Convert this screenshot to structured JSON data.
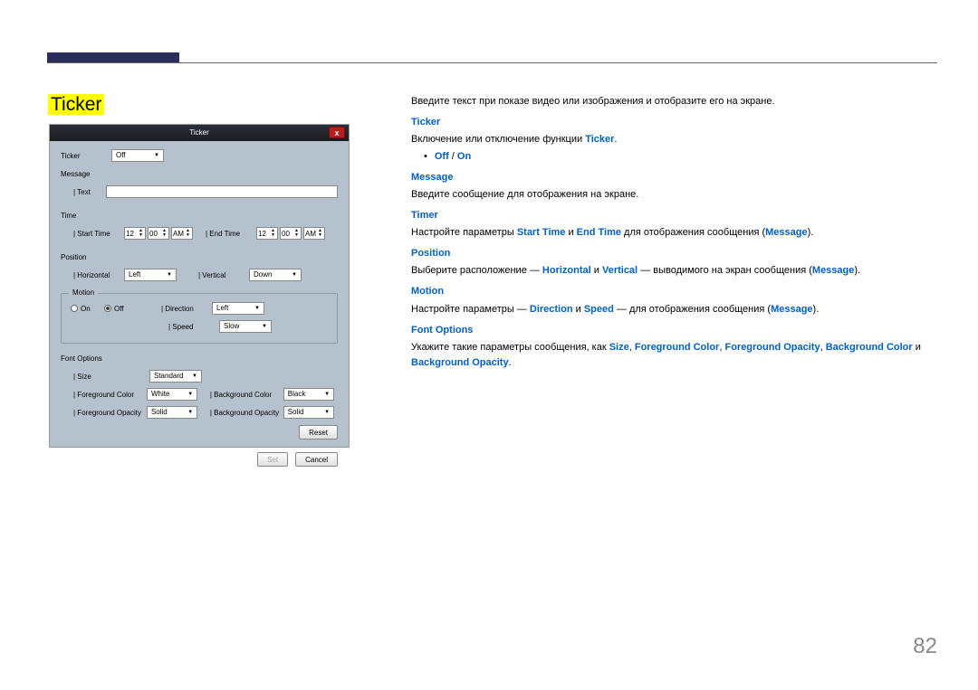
{
  "section_title": "Ticker",
  "panel": {
    "title": "Ticker",
    "close": "x",
    "ticker_label": "Ticker",
    "ticker_value": "Off",
    "message_label": "Message",
    "text_label": "| Text",
    "time_label": "Time",
    "start_time_label": "| Start Time",
    "start_hh": "12",
    "start_mm": "00",
    "start_ap": "AM",
    "end_time_label": "| End Time",
    "end_hh": "12",
    "end_mm": "00",
    "end_ap": "AM",
    "position_label": "Position",
    "horizontal_label": "| Horizontal",
    "horizontal_value": "Left",
    "vertical_label": "| Vertical",
    "vertical_value": "Down",
    "motion_group": "Motion",
    "on_label": "On",
    "off_label": "Off",
    "direction_label": "| Direction",
    "direction_value": "Left",
    "speed_label": "| Speed",
    "speed_value": "Slow",
    "font_options_label": "Font Options",
    "size_label": "| Size",
    "size_value": "Standard",
    "fg_color_label": "| Foreground Color",
    "fg_color_value": "White",
    "bg_color_label": "| Background Color",
    "bg_color_value": "Black",
    "fg_opacity_label": "| Foreground Opacity",
    "fg_opacity_value": "Solid",
    "bg_opacity_label": "| Background Opacity",
    "bg_opacity_value": "Solid",
    "reset_btn": "Reset",
    "set_btn": "Set",
    "cancel_btn": "Cancel"
  },
  "doc": {
    "intro": "Введите текст при показе видео или изображения и отобразите его на экране.",
    "ticker_hd": "Ticker",
    "ticker_p1a": "Включение или отключение функции ",
    "ticker_kw": "Ticker",
    "ticker_p1b": ".",
    "off": "Off",
    "slash": " / ",
    "on": "On",
    "message_hd": "Message",
    "message_p": "Введите сообщение для отображения на экране.",
    "timer_hd": "Timer",
    "timer_p1": "Настройте параметры ",
    "timer_start": "Start Time",
    "timer_and": " и ",
    "timer_end": "End Time",
    "timer_p2": " для отображения сообщения (",
    "timer_msg": "Message",
    "timer_p3": ").",
    "position_hd": "Position",
    "position_p1": "Выберите расположение — ",
    "position_h": "Horizontal",
    "position_and": " и ",
    "position_v": "Vertical",
    "position_p2": " — выводимого на экран сообщения (",
    "position_msg": "Message",
    "position_p3": ").",
    "motion_hd": "Motion",
    "motion_p1": "Настройте параметры — ",
    "motion_dir": "Direction",
    "motion_and": " и ",
    "motion_spd": "Speed",
    "motion_p2": " — для отображения сообщения (",
    "motion_msg": "Message",
    "motion_p3": ").",
    "font_hd": "Font Options",
    "font_p1": "Укажите такие параметры сообщения, как ",
    "font_size": "Size",
    "font_c1": ", ",
    "font_fgc": "Foreground Color",
    "font_c2": ", ",
    "font_fgo": "Foreground Opacity",
    "font_c3": ", ",
    "font_bgc": "Background Color",
    "font_and": " и ",
    "font_bgo": "Background Opacity",
    "font_p2": "."
  },
  "page_num": "82"
}
